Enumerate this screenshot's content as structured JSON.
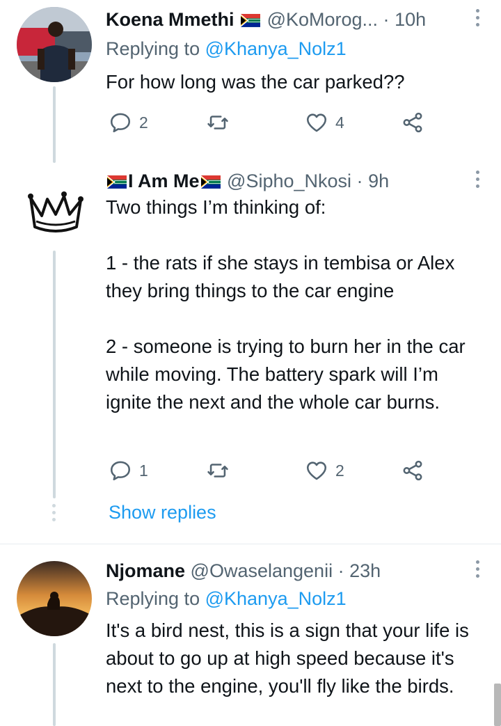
{
  "tweets": [
    {
      "name": "Koena Mmethi",
      "handle": "@KoMorog...",
      "sep": "·",
      "time": "10h",
      "reply_prefix": "Replying to",
      "reply_mention": "@Khanya_Nolz1",
      "text": "For how long was the car parked??",
      "replies": "2",
      "retweets": "",
      "likes": "4"
    },
    {
      "name": "I Am Me",
      "handle": "@Sipho_Nkosi",
      "sep": "·",
      "time": "9h",
      "text": "Two things I’m thinking of:\n\n1 - the rats if she stays in tembisa or Alex they bring things to the car engine\n\n2 - someone is trying to burn her in the car while moving. The battery spark will I’m ignite the next and the whole car burns.",
      "replies": "1",
      "retweets": "",
      "likes": "2",
      "show_replies": "Show replies"
    },
    {
      "name": "Njomane",
      "handle": "@Owaselangenii",
      "sep": "·",
      "time": "23h",
      "reply_prefix": "Replying to",
      "reply_mention": "@Khanya_Nolz1",
      "text": "It's a bird nest, this is a sign that your life is about to go up at high speed because it's next to the engine, you'll fly like the birds."
    }
  ],
  "colors": {
    "accent": "#1d9bf0",
    "secondary": "#536471",
    "thread": "#cfd9de"
  },
  "icons": [
    "reply-icon",
    "retweet-icon",
    "like-icon",
    "share-icon",
    "more-icon",
    "south-africa-flag-icon"
  ]
}
